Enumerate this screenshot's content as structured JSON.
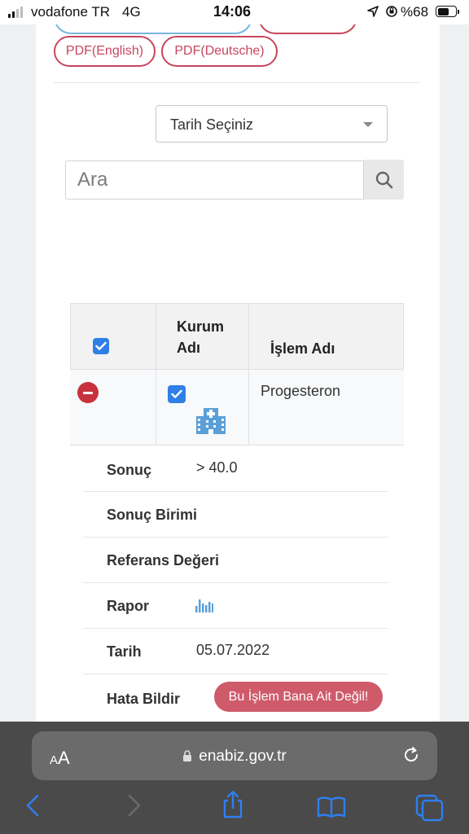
{
  "status_bar": {
    "carrier": "vodafone TR",
    "network": "4G",
    "time": "14:06",
    "battery": "%68",
    "battery_level": 0.68
  },
  "pdf_buttons": [
    {
      "label": "PDF(English)"
    },
    {
      "label": "PDF(Deutsche)"
    }
  ],
  "date_select": {
    "selected": "Tarih Seçiniz"
  },
  "search": {
    "placeholder": "Ara",
    "value": ""
  },
  "table": {
    "headers": {
      "institution": "Kurum Adı",
      "procedure": "İşlem Adı"
    },
    "row": {
      "procedure": "Progesteron"
    }
  },
  "details": [
    {
      "label": "Sonuç",
      "value": "> 40.0"
    },
    {
      "label": "Sonuç Birimi",
      "value": ""
    },
    {
      "label": "Referans Değeri",
      "value": ""
    },
    {
      "label": "Rapor",
      "value": ""
    },
    {
      "label": "Tarih",
      "value": "05.07.2022"
    },
    {
      "label": "Hata Bildir",
      "value": ""
    }
  ],
  "report_error_button": "Bu İşlem Bana Ait Değil!",
  "browser": {
    "aa_label": "AA",
    "url": "enabiz.gov.tr"
  },
  "colors": {
    "accent_red": "#c9465d",
    "checkbox_blue": "#2f7fe6",
    "ios_blue": "#2f7ff0",
    "error_button": "#cf5a6a"
  }
}
